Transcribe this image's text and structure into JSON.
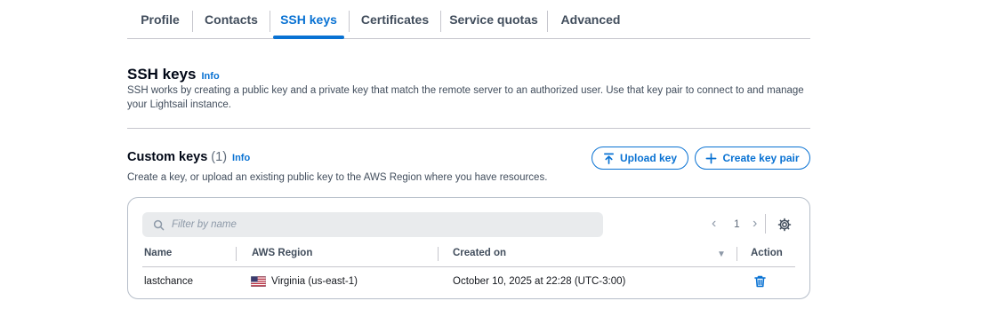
{
  "tabs": [
    {
      "label": "Profile",
      "active": false
    },
    {
      "label": "Contacts",
      "active": false
    },
    {
      "label": "SSH keys",
      "active": true
    },
    {
      "label": "Certificates",
      "active": false
    },
    {
      "label": "Service quotas",
      "active": false
    },
    {
      "label": "Advanced",
      "active": false
    }
  ],
  "header": {
    "title": "SSH keys",
    "info": "Info",
    "description": "SSH works by creating a public key and a private key that match the remote server to an authorized user. Use that key pair to connect to and manage your Lightsail instance."
  },
  "custom_keys": {
    "title": "Custom keys",
    "count": "(1)",
    "info": "Info",
    "description": "Create a key, or upload an existing public key to the AWS Region where you have resources.",
    "upload_label": "Upload key",
    "create_label": "Create key pair"
  },
  "table": {
    "filter_placeholder": "Filter by name",
    "page": "1",
    "columns": [
      "Name",
      "AWS Region",
      "Created on",
      "Action"
    ],
    "rows": [
      {
        "name": "lastchance",
        "region": "Virginia (us-east-1)",
        "created": "October 10, 2025 at 22:28 (UTC-3:00)",
        "flag": "us-flag-icon"
      }
    ]
  },
  "colors": {
    "accent": "#0972d3",
    "text": "#16191f",
    "muted": "#414d5c",
    "border": "#c6c6cd"
  }
}
